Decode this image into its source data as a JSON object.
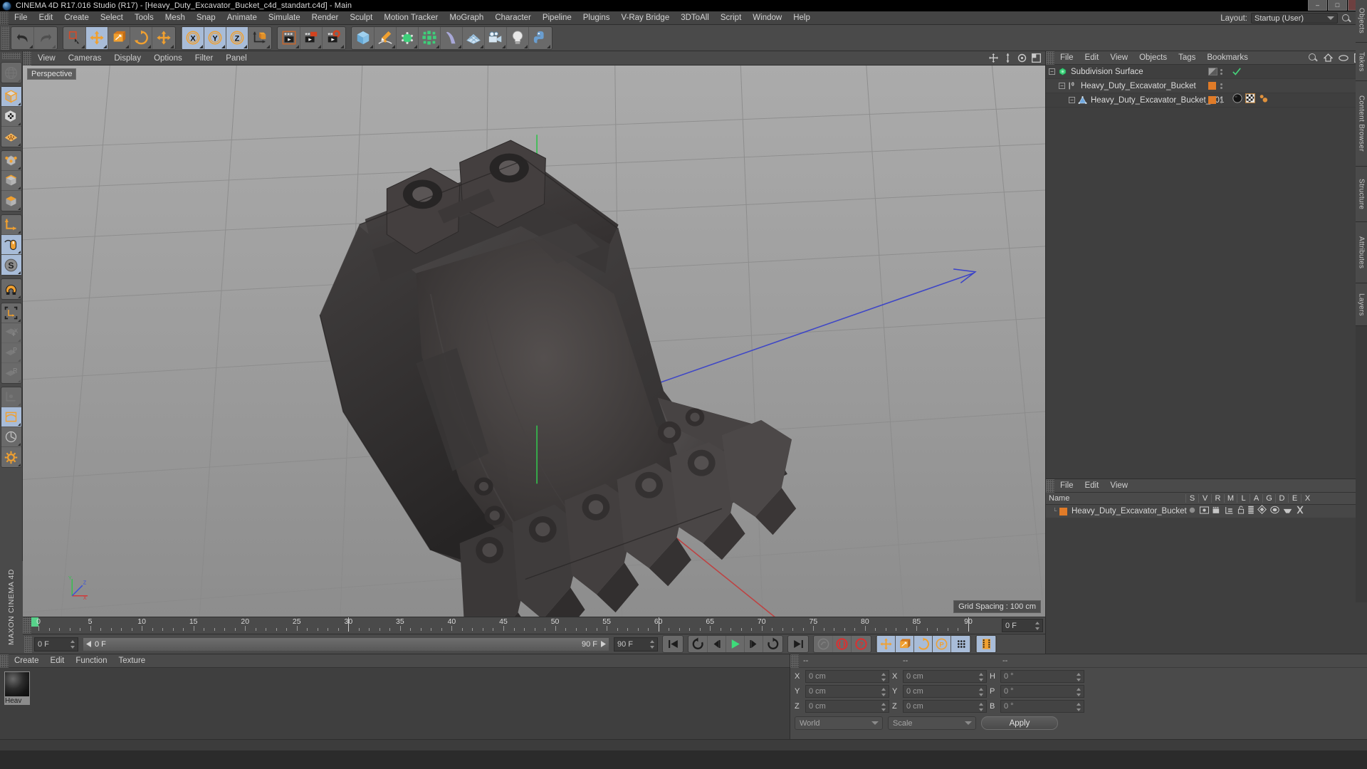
{
  "window": {
    "title": "CINEMA 4D R17.016 Studio (R17) - [Heavy_Duty_Excavator_Bucket_c4d_standart.c4d] - Main",
    "minimize": "–",
    "maximize": "□",
    "close": "✕"
  },
  "menubar": {
    "items": [
      "File",
      "Edit",
      "Create",
      "Select",
      "Tools",
      "Mesh",
      "Snap",
      "Animate",
      "Simulate",
      "Render",
      "Sculpt",
      "Motion Tracker",
      "MoGraph",
      "Character",
      "Pipeline",
      "Plugins",
      "V-Ray Bridge",
      "3DToAll",
      "Script",
      "Window",
      "Help"
    ],
    "layout_label": "Layout:",
    "layout_value": "Startup (User)"
  },
  "toolbar": {
    "groups": [
      {
        "name": "undo-redo",
        "buttons": [
          {
            "name": "undo",
            "icon": "undo-icon",
            "selected": false,
            "dim": false
          },
          {
            "name": "redo",
            "icon": "redo-icon",
            "selected": false,
            "dim": true
          }
        ]
      },
      {
        "name": "selection-transform",
        "buttons": [
          {
            "name": "live-selection",
            "icon": "live-selection-icon",
            "selected": false,
            "dim": false
          },
          {
            "name": "move",
            "icon": "move-icon",
            "selected": true,
            "dim": false
          },
          {
            "name": "scale",
            "icon": "scale-icon",
            "selected": false,
            "dim": false
          },
          {
            "name": "rotate",
            "icon": "rotate-icon",
            "selected": false,
            "dim": false
          },
          {
            "name": "move-dynamic",
            "icon": "move-icon",
            "selected": false,
            "dim": false
          }
        ]
      },
      {
        "name": "axis-locks",
        "buttons": [
          {
            "name": "lock-x",
            "icon": "x-axis-icon",
            "selected": true,
            "dim": false
          },
          {
            "name": "lock-y",
            "icon": "y-axis-icon",
            "selected": true,
            "dim": false
          },
          {
            "name": "lock-z",
            "icon": "z-axis-icon",
            "selected": true,
            "dim": false
          },
          {
            "name": "world-object-coords",
            "icon": "world-coord-icon",
            "selected": false,
            "dim": false
          }
        ]
      },
      {
        "name": "render",
        "buttons": [
          {
            "name": "render-view",
            "icon": "render-view-icon",
            "selected": false,
            "dim": false
          },
          {
            "name": "render-to-picture-viewer",
            "icon": "render-picture-icon",
            "selected": false,
            "dim": false
          },
          {
            "name": "render-settings",
            "icon": "render-settings-icon",
            "selected": false,
            "dim": false
          }
        ]
      },
      {
        "name": "create-objects",
        "buttons": [
          {
            "name": "add-cube",
            "icon": "cube-icon",
            "selected": false,
            "dim": false
          },
          {
            "name": "add-spline",
            "icon": "pen-spline-icon",
            "selected": false,
            "dim": false
          },
          {
            "name": "add-generator",
            "icon": "nurbs-generator-icon",
            "selected": false,
            "dim": false
          },
          {
            "name": "add-array",
            "icon": "array-icon",
            "selected": false,
            "dim": false
          },
          {
            "name": "add-deformer",
            "icon": "bend-deformer-icon",
            "selected": false,
            "dim": false
          },
          {
            "name": "add-scene-object",
            "icon": "floor-scene-icon",
            "selected": false,
            "dim": false
          },
          {
            "name": "add-camera",
            "icon": "camera-icon",
            "selected": false,
            "dim": false
          },
          {
            "name": "add-light",
            "icon": "light-bulb-icon",
            "selected": false,
            "dim": false
          },
          {
            "name": "python-script",
            "icon": "python-icon",
            "selected": false,
            "dim": false
          }
        ]
      }
    ]
  },
  "left_toolbar": {
    "groups": [
      {
        "name": "group-0",
        "buttons": [
          {
            "name": "make-editable",
            "icon": "globe-editable-icon",
            "selected": false,
            "dim": true
          }
        ]
      },
      {
        "name": "group-1",
        "buttons": [
          {
            "name": "model-mode",
            "icon": "model-mode-icon",
            "selected": true,
            "dim": false
          },
          {
            "name": "texture-mode",
            "icon": "texture-mode-icon",
            "selected": false,
            "dim": false
          },
          {
            "name": "points-mode",
            "icon": "points-grid-icon",
            "selected": false,
            "dim": false
          }
        ]
      },
      {
        "name": "group-2",
        "buttons": [
          {
            "name": "points-edit",
            "icon": "point-edit-icon",
            "selected": false,
            "dim": false
          },
          {
            "name": "edges-edit",
            "icon": "edge-edit-icon",
            "selected": false,
            "dim": false
          },
          {
            "name": "polygons-edit",
            "icon": "polygon-edit-icon",
            "selected": false,
            "dim": false
          }
        ]
      },
      {
        "name": "group-3",
        "buttons": [
          {
            "name": "axis-modify",
            "icon": "axis-modify-icon",
            "selected": false,
            "dim": false
          },
          {
            "name": "viewport-solo",
            "icon": "mouse-viewport-icon",
            "selected": true,
            "dim": false
          },
          {
            "name": "soft-selection",
            "icon": "soft-selection-icon",
            "selected": true,
            "dim": false
          }
        ]
      },
      {
        "name": "group-4",
        "buttons": [
          {
            "name": "snap-toggle",
            "icon": "magnet-snap-icon",
            "selected": false,
            "dim": false
          }
        ]
      },
      {
        "name": "group-5",
        "buttons": [
          {
            "name": "workplane",
            "icon": "workplane-axis-icon",
            "selected": false,
            "dim": false
          },
          {
            "name": "lock-workplane-x",
            "icon": "plane-x-icon",
            "selected": false,
            "dim": true
          },
          {
            "name": "lock-workplane-p",
            "icon": "plane-p-icon",
            "selected": false,
            "dim": true
          },
          {
            "name": "lock-workplane-r",
            "icon": "plane-r-icon",
            "selected": false,
            "dim": true
          }
        ]
      },
      {
        "name": "group-6",
        "buttons": [
          {
            "name": "enable-axis",
            "icon": "axis-enable-icon",
            "selected": false,
            "dim": true
          },
          {
            "name": "enable-deform",
            "icon": "deform-enable-icon",
            "selected": true,
            "dim": false
          },
          {
            "name": "quantize",
            "icon": "quantize-icon",
            "selected": false,
            "dim": false
          },
          {
            "name": "settings-gear",
            "icon": "gear-icon",
            "selected": false,
            "dim": false
          }
        ]
      }
    ],
    "brand": "MAXON CINEMA 4D"
  },
  "viewport": {
    "menu": [
      "View",
      "Cameras",
      "Display",
      "Options",
      "Filter",
      "Panel"
    ],
    "label": "Perspective",
    "grid_spacing": "Grid Spacing : 100 cm",
    "axis_labels": {
      "x": "X",
      "y": "Y",
      "z": "Z"
    }
  },
  "timeline": {
    "ticks": [
      0,
      5,
      10,
      15,
      20,
      25,
      30,
      35,
      40,
      45,
      50,
      55,
      60,
      65,
      70,
      75,
      80,
      85,
      90
    ],
    "start_frame": "0 F",
    "end_frame": "90 F",
    "current_frame_left": "0 F",
    "current_frame_marker": "0 F",
    "preview_end": "90 F"
  },
  "transport": {
    "buttons": [
      {
        "name": "go-to-start",
        "icon": "skip-start-icon",
        "selected": false,
        "dim": false
      },
      {
        "name": "play-reverse-loop",
        "icon": "loop-reverse-icon",
        "selected": false,
        "dim": false
      },
      {
        "name": "previous-frame",
        "icon": "step-back-icon",
        "selected": false,
        "dim": false
      },
      {
        "name": "play",
        "icon": "play-icon",
        "selected": false,
        "dim": false
      },
      {
        "name": "next-frame",
        "icon": "step-forward-icon",
        "selected": false,
        "dim": false
      },
      {
        "name": "play-forward-loop",
        "icon": "loop-forward-icon",
        "selected": false,
        "dim": false
      },
      {
        "name": "go-to-end",
        "icon": "skip-end-icon",
        "selected": false,
        "dim": false
      },
      {
        "name": "record-active-objects",
        "icon": "record-disabled-icon",
        "selected": false,
        "dim": true
      },
      {
        "name": "autokeying",
        "icon": "autokey-icon",
        "selected": false,
        "dim": false
      },
      {
        "name": "keyframe-selection",
        "icon": "keyframe-question-icon",
        "selected": false,
        "dim": false
      },
      {
        "name": "record-position",
        "icon": "record-position-icon",
        "selected": true,
        "dim": false
      },
      {
        "name": "record-scale",
        "icon": "record-scale-icon",
        "selected": true,
        "dim": false
      },
      {
        "name": "record-rotation",
        "icon": "record-rotation-icon",
        "selected": true,
        "dim": false
      },
      {
        "name": "record-parameter",
        "icon": "record-param-icon",
        "selected": true,
        "dim": false
      },
      {
        "name": "record-pla",
        "icon": "record-pla-icon",
        "selected": true,
        "dim": false
      },
      {
        "name": "timeline-toggle",
        "icon": "timeline-strip-icon",
        "selected": true,
        "dim": false
      }
    ]
  },
  "material_manager": {
    "menu": [
      "Create",
      "Edit",
      "Function",
      "Texture"
    ],
    "materials": [
      {
        "name": "Heav",
        "full": "Heavy_Duty_Excavator_Bucket"
      }
    ]
  },
  "coordinates": {
    "headers": [
      "--",
      "--",
      "--"
    ],
    "rows": [
      {
        "label_pos": "X",
        "value_pos": "0 cm",
        "label_size": "X",
        "value_size": "0 cm",
        "label_rot": "H",
        "value_rot": "0 °"
      },
      {
        "label_pos": "Y",
        "value_pos": "0 cm",
        "label_size": "Y",
        "value_size": "0 cm",
        "label_rot": "P",
        "value_rot": "0 °"
      },
      {
        "label_pos": "Z",
        "value_pos": "0 cm",
        "label_size": "Z",
        "value_size": "0 cm",
        "label_rot": "B",
        "value_rot": "0 °"
      }
    ],
    "coord_system": "World",
    "mode": "Scale",
    "apply_label": "Apply"
  },
  "object_manager": {
    "menu": [
      "File",
      "Edit",
      "View",
      "Objects",
      "Tags",
      "Bookmarks"
    ],
    "rows": [
      {
        "name": "Subdivision Surface",
        "icon": "subdivision-surface-icon",
        "indent": 14,
        "marker": "checker",
        "check": true
      },
      {
        "name": "Heavy_Duty_Excavator_Bucket",
        "icon": "null-layer-icon",
        "indent": 28,
        "marker": "orange",
        "check": false
      },
      {
        "name": "Heavy_Duty_Excavator_Bucket_001",
        "icon": "polygon-object-icon",
        "indent": 42,
        "marker": "orange",
        "check": false,
        "tags": [
          "material-tag",
          "uvw-tag",
          "selection-tag"
        ]
      }
    ]
  },
  "layer_manager": {
    "menu": [
      "File",
      "Edit",
      "View"
    ],
    "columns": [
      "Name",
      "S",
      "V",
      "R",
      "M",
      "L",
      "A",
      "G",
      "D",
      "E",
      "X"
    ],
    "rows": [
      {
        "name": "Heavy_Duty_Excavator_Bucket",
        "color": "#e07b28"
      }
    ]
  },
  "right_tabs": [
    "Objects",
    "Takes",
    "Content Browser",
    "Structure",
    "Attributes",
    "Layers"
  ],
  "colors": {
    "accent_orange": "#e07b28",
    "selected_blue": "#a8bcd8",
    "panel_bg": "#4a4a4a",
    "dark_bg": "#3f3f3f",
    "green_axis": "#35c04a",
    "blue_axis": "#3a50d8",
    "red_axis": "#d03a3a"
  }
}
